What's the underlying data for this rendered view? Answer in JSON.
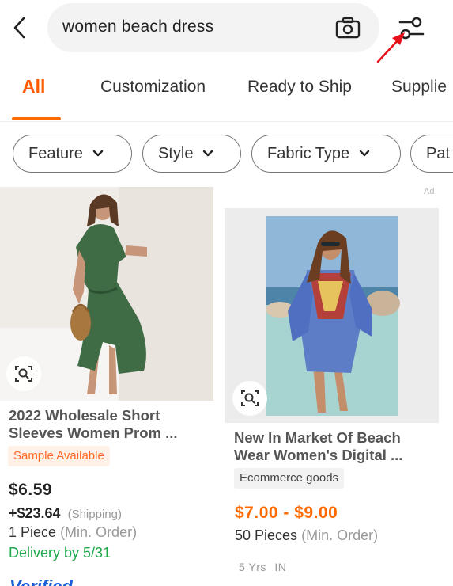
{
  "search": {
    "query": "women beach dress"
  },
  "tabs": [
    {
      "label": "All"
    },
    {
      "label": "Customization"
    },
    {
      "label": "Ready to Ship"
    },
    {
      "label": "Supplie"
    }
  ],
  "filters": [
    {
      "label": "Feature"
    },
    {
      "label": "Style"
    },
    {
      "label": "Fabric Type"
    },
    {
      "label": "Pat"
    }
  ],
  "ad_label": "Ad",
  "products": [
    {
      "title_line1": "2022 Wholesale Short",
      "title_line2": "Sleeves Women Prom ...",
      "tag": "Sample Available",
      "price": "$6.59",
      "shipping_amount": "+$23.64",
      "shipping_label": "(Shipping)",
      "moq_qty": "1 Piece",
      "moq_label": "(Min. Order)",
      "delivery": "Delivery by 5/31",
      "verified": "Verified"
    },
    {
      "title_line1": "New In Market Of Beach",
      "title_line2": "Wear Women's Digital ...",
      "tag": "Ecommerce goods",
      "price": "$7.00 - $9.00",
      "moq_qty": "50 Pieces",
      "moq_label": "(Min. Order)",
      "supplier_years": "5 Yrs",
      "supplier_country": "IN"
    }
  ],
  "colors": {
    "accent": "#ff6a00",
    "delivery": "#1ea84a",
    "verified": "#1a5fd6",
    "annotation_arrow": "#e8101a"
  },
  "icons": [
    "back-icon",
    "camera-icon",
    "filter-settings-icon",
    "chevron-down-icon",
    "image-search-icon",
    "annotation-arrow"
  ]
}
